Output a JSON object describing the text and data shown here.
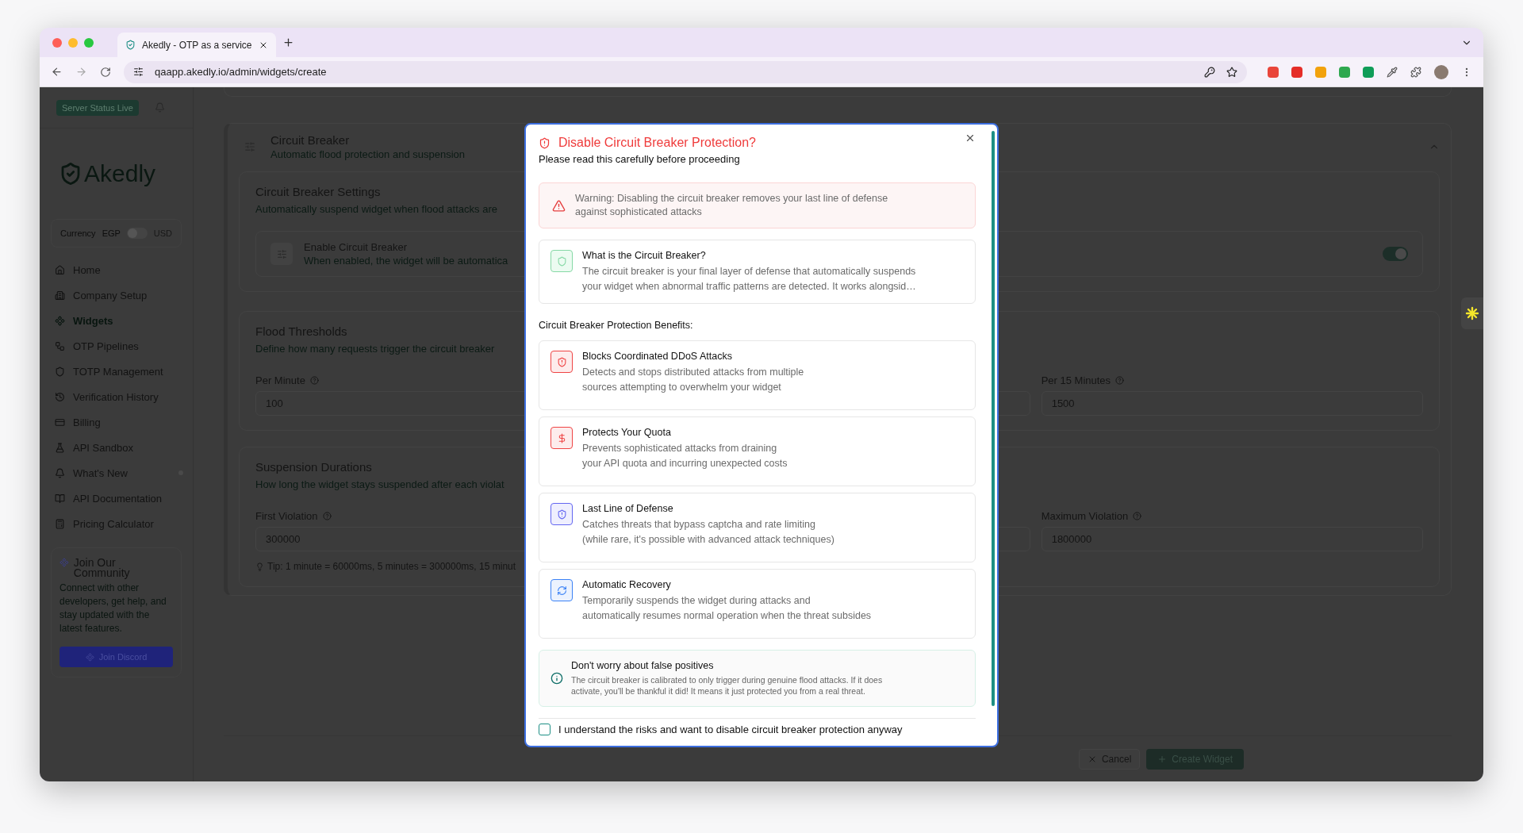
{
  "browser": {
    "tab_title": "Akedly - OTP as a service",
    "url": "qaapp.akedly.io/admin/widgets/create"
  },
  "sidebar": {
    "status_badge": "Server Status Live",
    "logo": "Akedly",
    "currency": {
      "label": "Currency",
      "options": [
        "EGP",
        "USD"
      ],
      "on": false
    },
    "items": [
      {
        "label": "Home",
        "selected": false,
        "dot": false
      },
      {
        "label": "Company Setup",
        "selected": false,
        "dot": false
      },
      {
        "label": "Widgets",
        "selected": true,
        "dot": false
      },
      {
        "label": "OTP Pipelines",
        "selected": false,
        "dot": false
      },
      {
        "label": "TOTP Management",
        "selected": false,
        "dot": false
      },
      {
        "label": "Verification History",
        "selected": false,
        "dot": false
      },
      {
        "label": "Billing",
        "selected": false,
        "dot": false
      },
      {
        "label": "API Sandbox",
        "selected": false,
        "dot": false
      },
      {
        "label": "What's New",
        "selected": false,
        "dot": true
      },
      {
        "label": "API Documentation",
        "selected": false,
        "dot": false
      },
      {
        "label": "Pricing Calculator",
        "selected": false,
        "dot": false
      }
    ],
    "community": {
      "title": "Join Our Community",
      "text": "Connect with other developers, get help, and stay updated with the latest features.",
      "button": "Join Discord"
    }
  },
  "section": {
    "title": "Circuit Breaker",
    "subtitle": "Automatic flood protection and suspension",
    "settings": {
      "title": "Circuit Breaker Settings",
      "subtitle": "Automatically suspend widget when flood attacks are",
      "toggle_title": "Enable Circuit Breaker",
      "toggle_text": "When enabled, the widget will be automatica",
      "on": true
    },
    "thresholds": {
      "title": "Flood Thresholds",
      "subtitle": "Define how many requests trigger the circuit breaker",
      "fields": [
        {
          "label": "Per Minute",
          "value": "100"
        },
        {
          "label": "Per 15 Minutes",
          "value": "1500"
        }
      ]
    },
    "durations": {
      "title": "Suspension Durations",
      "subtitle": "How long the widget stays suspended after each violat",
      "fields": [
        {
          "label": "First Violation",
          "value": "300000"
        },
        {
          "label": "Maximum Violation",
          "value": "1800000"
        }
      ],
      "tip": "Tip: 1 minute = 60000ms, 5 minutes = 300000ms, 15 minut"
    }
  },
  "footer": {
    "cancel": "Cancel",
    "create": "Create Widget"
  },
  "modal": {
    "title": "Disable Circuit Breaker Protection?",
    "subtitle": "Please read this carefully before proceeding",
    "warning": "Warning: Disabling the circuit breaker removes your last line of defense\nagainst sophisticated attacks",
    "about": {
      "title": "What is the Circuit Breaker?",
      "text": "The circuit breaker is your final layer of defense that automatically suspends\nyour widget when abnormal traffic patterns are detected. It works alongsid…"
    },
    "benefits_title": "Circuit Breaker Protection Benefits:",
    "benefits": [
      {
        "title": "Blocks Coordinated DDoS Attacks",
        "text": "Detects and stops distributed attacks from multiple\nsources attempting to overwhelm your widget",
        "color": "#ef4444"
      },
      {
        "title": "Protects Your Quota",
        "text": "Prevents sophisticated attacks from draining\nyour API quota and incurring unexpected costs",
        "color": "#ef4444"
      },
      {
        "title": "Last Line of Defense",
        "text": "Catches threats that bypass captcha and rate limiting\n(while rare, it's possible with advanced attack techniques)",
        "color": "#6366f1"
      },
      {
        "title": "Automatic Recovery",
        "text": "Temporarily suspends the widget during attacks and\nautomatically resumes normal operation when the threat subsides",
        "color": "#3b82f6"
      }
    ],
    "note": {
      "title": "Don't worry about false positives",
      "text": "The circuit breaker is calibrated to only trigger during genuine flood attacks. If it does\nactivate, you'll be thankful it did! It means it just protected you from a real threat."
    },
    "confirm": {
      "label": "I understand the risks and want to disable circuit breaker protection anyway",
      "checked": false
    }
  }
}
